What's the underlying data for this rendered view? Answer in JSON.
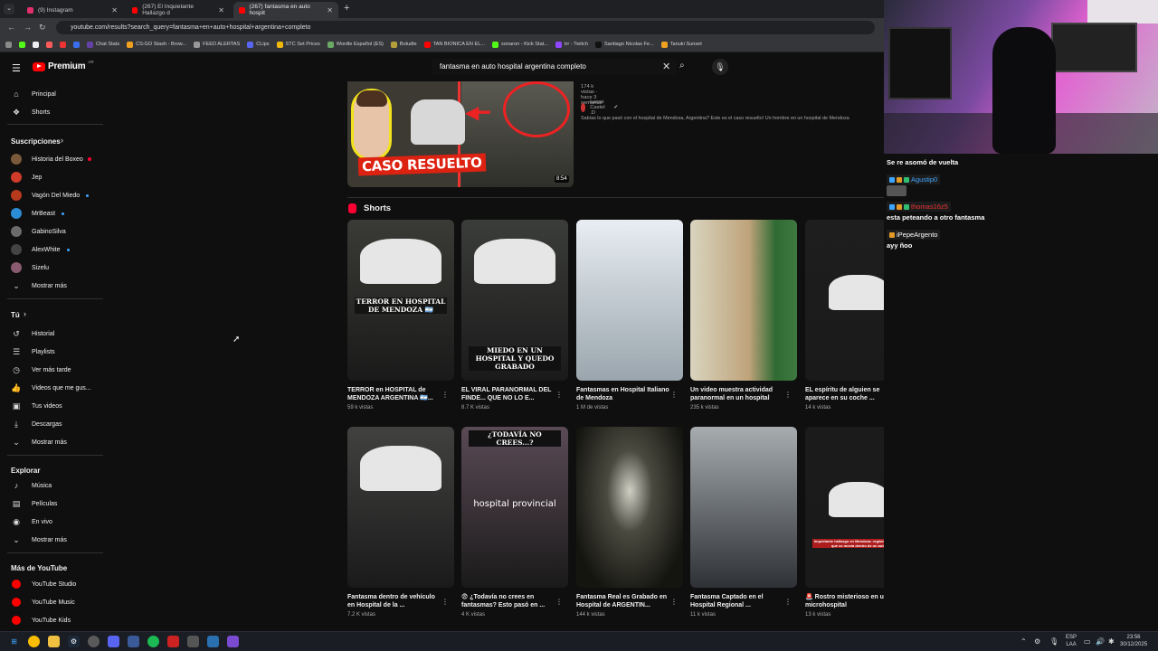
{
  "browser": {
    "tabs": [
      {
        "title": "(9) Instagram",
        "active": false,
        "color": "#e1306c"
      },
      {
        "title": "(267) El Inquietante Hallazgo d",
        "active": false,
        "color": "#ff0000"
      },
      {
        "title": "(267) fantasma en auto hospit",
        "active": true,
        "color": "#ff0000"
      }
    ],
    "url": "youtube.com/results?search_query=fantasma+en+auto+hospital+argentina+completo",
    "bookmarks": [
      {
        "label": "Chat Stats",
        "color": "#6441a5"
      },
      {
        "label": "CS:GO Stash - Brow...",
        "color": "#f0a020"
      },
      {
        "label": "FEED ALERTAS",
        "color": "#999"
      },
      {
        "label": "CLips",
        "color": "#5865f2"
      },
      {
        "label": "STC Set Prices",
        "color": "#f0b90b"
      },
      {
        "label": "Wordle Español (ES)",
        "color": "#6aaa64"
      },
      {
        "label": "Boludle",
        "color": "#b59f3b"
      },
      {
        "label": "TAN BIONICA EN EL...",
        "color": "#ff0000"
      },
      {
        "label": "sonaron - Kick Stat...",
        "color": "#53fc18"
      },
      {
        "label": "trr - Twitch",
        "color": "#9146ff"
      },
      {
        "label": "Santiago Nicolas Fe...",
        "color": "#111"
      },
      {
        "label": "Tanuki Sunset",
        "color": "#f0a020"
      }
    ]
  },
  "header": {
    "logo_text": "Premium",
    "logo_region": "AR",
    "search_value": "fantasma en auto hospital argentina completo"
  },
  "sidebar": {
    "top": [
      {
        "label": "Principal",
        "icon": "home-icon",
        "glyph": "⌂"
      },
      {
        "label": "Shorts",
        "icon": "shorts-icon",
        "glyph": "❖"
      }
    ],
    "subs_title": "Suscripciones",
    "subs": [
      {
        "label": "Historia del Boxeo",
        "color": "#7a5a3a",
        "live": true
      },
      {
        "label": "Jep",
        "color": "#d13b2a",
        "live": false
      },
      {
        "label": "Vagón Del Miedo",
        "color": "#b83a1e",
        "live": false,
        "dot": true
      },
      {
        "label": "MrBeast",
        "color": "#2b8dd6",
        "live": false,
        "dot": true
      },
      {
        "label": "GabinoSilva",
        "color": "#6b6b6b",
        "live": false
      },
      {
        "label": "AlexWhite",
        "color": "#444",
        "live": false,
        "dot": true
      },
      {
        "label": "Sizelu",
        "color": "#8a5a70",
        "live": false
      }
    ],
    "subs_more": "Mostrar más",
    "you_title": "Tú",
    "you": [
      {
        "label": "Historial",
        "icon": "history-icon",
        "glyph": "↺"
      },
      {
        "label": "Playlists",
        "icon": "playlists-icon",
        "glyph": "☰"
      },
      {
        "label": "Ver más tarde",
        "icon": "clock-icon",
        "glyph": "◷"
      },
      {
        "label": "Videos que me gus...",
        "icon": "like-icon",
        "glyph": "👍"
      },
      {
        "label": "Tus videos",
        "icon": "your-videos-icon",
        "glyph": "▣"
      },
      {
        "label": "Descargas",
        "icon": "download-icon",
        "glyph": "⤓"
      }
    ],
    "you_more": "Mostrar más",
    "explore_title": "Explorar",
    "explore": [
      {
        "label": "Música",
        "icon": "music-icon",
        "glyph": "♪"
      },
      {
        "label": "Películas",
        "icon": "movies-icon",
        "glyph": "▤"
      },
      {
        "label": "En vivo",
        "icon": "live-icon",
        "glyph": "◉"
      }
    ],
    "explore_more": "Mostrar más",
    "more_title": "Más de YouTube",
    "more": [
      {
        "label": "YouTube Studio",
        "color": "#ff0000"
      },
      {
        "label": "YouTube Music",
        "color": "#ff0000"
      },
      {
        "label": "YouTube Kids",
        "color": "#ff0000"
      }
    ]
  },
  "top_video": {
    "caption": "CASO RESUELTO",
    "duration": "8:54",
    "meta": "174 k vistas · hace 3 semanas",
    "channel": "Lucas Castel .D",
    "description": "Sabías lo que pasó con el hospital de Mendoza, Argentina? Este es el caso resuelto! Un hombre en un hospital de Mendoza"
  },
  "shorts": {
    "title": "Shorts",
    "items": [
      {
        "title": "TERROR en HOSPITAL de MENDOZA ARGENTINA 🇦🇷...",
        "views": "59 k vistas",
        "overlay": "TERROR EN HOSPITAL DE MENDOZA 🇦🇷",
        "bg": "#3a3a36"
      },
      {
        "title": "EL VIRAL PARANORMAL DEL FINDE... QUE NO LO E...",
        "views": "8.7 K vistas",
        "overlay": "MIEDO EN UN HOSPITAL Y QUEDO GRABADO",
        "bg": "#3b3d3a"
      },
      {
        "title": "Fantasmas en Hospital Italiano de Mendoza",
        "views": "1 M de vistas",
        "overlay": "",
        "bg": "#cfd6dd"
      },
      {
        "title": "Un video muestra actividad paranormal en un hospital",
        "views": "235 k vistas",
        "overlay": "",
        "bg": "#7a6a4a"
      },
      {
        "title": "EL espíritu de alguien se aparece en su coche ...",
        "views": "14 k vistas",
        "overlay": "",
        "bg": "#1e1e1e"
      },
      {
        "title": "Fantasma dentro de vehículo en Hospital de la ...",
        "views": "7.2 K vistas",
        "overlay": "",
        "bg": "#414240"
      },
      {
        "title": "😨 ¿Todavía no crees en fantasmas? Esto pasó en ...",
        "views": "4 K vistas",
        "overlay": "¿TODAVÍA NO CREES...?",
        "overlay2": "hospital provincial",
        "bg": "#5a4a55"
      },
      {
        "title": "Fantasma Real es Grabado en Hospital de ARGENTIN...",
        "views": "144 k vistas",
        "overlay": "",
        "bg": "#2b2b26"
      },
      {
        "title": "Fantasma Captado en el Hospital Regional ...",
        "views": "11 k vistas",
        "overlay": "",
        "bg": "#4a4d50"
      },
      {
        "title": "🚨 Rostro misterioso en un microhospital",
        "views": "13 k vistas",
        "overlay": "Inquietante hallazgo en Mendoza: registró un rostro que se movía dentro de un auto",
        "bg": "#1b1b1b"
      }
    ]
  },
  "chat": {
    "messages": [
      {
        "user": "",
        "text": "Se re asomó de vuelta"
      },
      {
        "user": "Agustip0",
        "user_color": "#3ea6ff",
        "text": ""
      },
      {
        "user": "thomas16z5",
        "user_color": "#e33",
        "text": "esta peteando a otro fantasma"
      },
      {
        "user": "iPepeArgento",
        "user_color": "#ffffff",
        "text": "ayy ñoo"
      }
    ]
  },
  "taskbar": {
    "lang": "ESP",
    "lang2": "LAA",
    "time": "23:56",
    "date": "30/12/2025"
  }
}
